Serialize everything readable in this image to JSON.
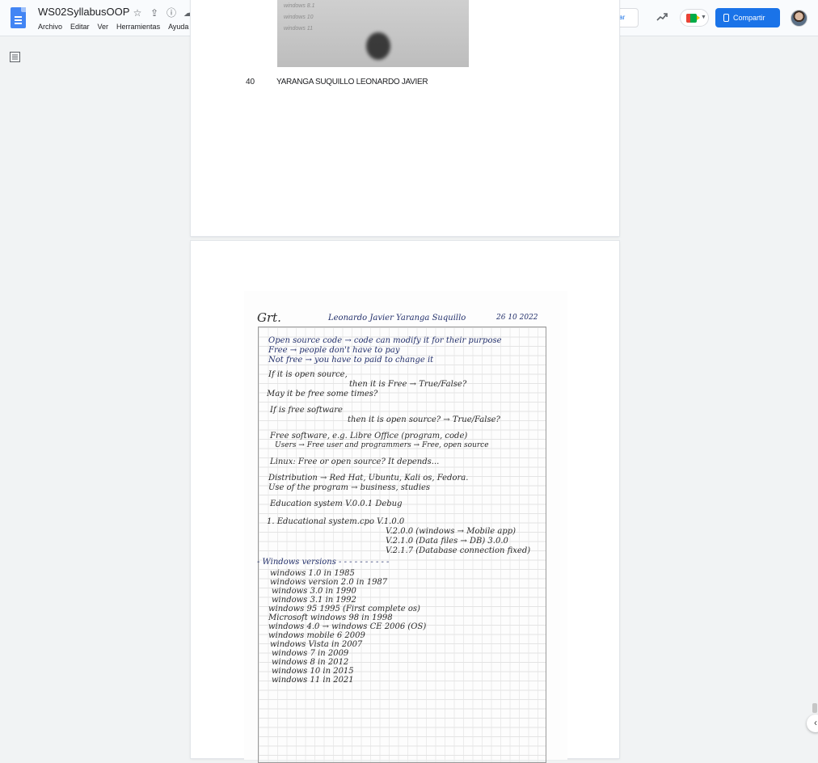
{
  "app": {
    "doc_title": "WS02SyllabusOOP",
    "menu": [
      "Archivo",
      "Editar",
      "Ver",
      "Herramientas",
      "Ayuda"
    ],
    "request_edit_label": "Solicitar permiso para editar",
    "share_label": "Compartir",
    "icons": [
      "docs-logo-icon",
      "star-icon",
      "move-to-drive-icon",
      "info-icon",
      "cloud-status-icon",
      "trending-icon",
      "meet-icon",
      "lock-icon",
      "outline-icon",
      "chevron-left-icon"
    ]
  },
  "page1": {
    "photo_lines": [
      "windows 8.1",
      "windows 10",
      "windows 11"
    ],
    "row_number": "40",
    "row_name": "YARANGA SUQUILLO LEONARDO JAVIER"
  },
  "note": {
    "header_left": "Grt.",
    "header_name": "Leonardo Javier Yaranga Suquillo",
    "header_date": "26 10 2022",
    "lines": [
      "Open source code → code can modify it for their purpose",
      "Free → people don't have to pay",
      "Not free → you have to paid to change it",
      "If it is open source,",
      "then it is Free → True/False?",
      "May it be free some times?",
      "If is free software",
      "then it is open source? → True/False?",
      "Free software, e.g. Libre Office (program, code)",
      "Users → Free    user and programmers → Free, open source",
      "Linux: Free or open source?   It depends...",
      "Distribution → Red Hat, Ubuntu, Kali os, Fedora.",
      "Use of the program → business, studies",
      "Education system   V.0.0.1   Debug",
      "1. Educational system.cpo   V.1.0.0",
      "V.2.0.0  (windows → Mobile app)",
      "V.2.1.0  (Data files → DB) 3.0.0",
      "V.2.1.7  (Database connection fixed)",
      "- Windows versions - - - - - - - - - -",
      "windows 1.0  in 1985",
      "windows version 2.0  in 1987",
      "windows 3.0  in 1990",
      "windows 3.1  in 1992",
      "windows 95  1995  (First complete os)",
      "Microsoft windows 98  in 1998",
      "windows 4.0 → windows CE 2006 (OS)",
      "windows mobile 6 2009",
      "windows Vista  in 2007",
      "windows 7  in 2009",
      "windows 8  in 2012",
      "windows 10  in 2015",
      "windows 11  in 2021"
    ]
  }
}
